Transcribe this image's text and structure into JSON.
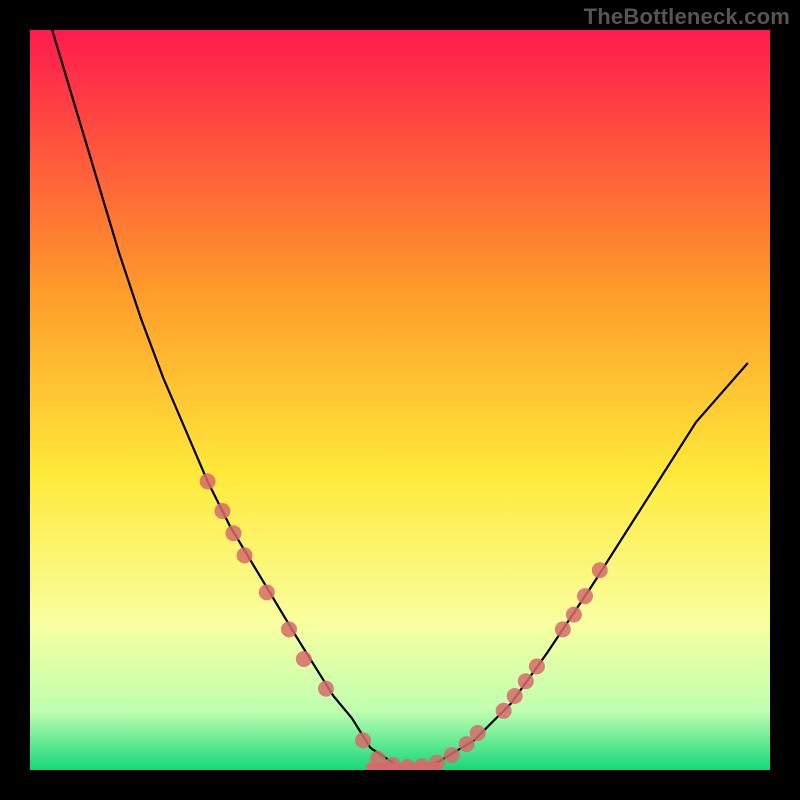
{
  "watermark": "TheBottleneck.com",
  "chart_data": {
    "type": "line",
    "title": "",
    "xlabel": "",
    "ylabel": "",
    "xlim": [
      0,
      100
    ],
    "ylim": [
      0,
      100
    ],
    "grid": false,
    "background_gradient": {
      "top": "#ff1a4e",
      "mid_upper": "#ff9a2a",
      "mid": "#ffe93a",
      "mid_lower": "#f9ffa0",
      "near_bottom": "#bfffb0",
      "bottom": "#15d87a"
    },
    "series": [
      {
        "name": "bottleneck-curve",
        "color": "#000000",
        "x": [
          3,
          6,
          9,
          12,
          15,
          18,
          21,
          24,
          27,
          30,
          33,
          36,
          38.5,
          41,
          43.5,
          46,
          49,
          52,
          55,
          60,
          65,
          70,
          76,
          83,
          90,
          97
        ],
        "y": [
          100,
          90,
          80,
          70,
          61,
          53,
          46,
          39,
          33,
          28,
          23,
          18,
          14,
          10,
          7,
          3,
          1,
          0,
          1,
          4,
          9,
          16,
          25,
          36,
          47,
          55
        ]
      }
    ],
    "markers": [
      {
        "name": "highlighted-points",
        "color": "#d66b6b",
        "radius": 8,
        "points": [
          {
            "x": 24,
            "y": 39
          },
          {
            "x": 26,
            "y": 35
          },
          {
            "x": 27.5,
            "y": 32
          },
          {
            "x": 29,
            "y": 29
          },
          {
            "x": 32,
            "y": 24
          },
          {
            "x": 35,
            "y": 19
          },
          {
            "x": 37,
            "y": 15
          },
          {
            "x": 40,
            "y": 11
          },
          {
            "x": 45,
            "y": 4
          },
          {
            "x": 47,
            "y": 1.5
          },
          {
            "x": 49,
            "y": 0.7
          },
          {
            "x": 51,
            "y": 0.4
          },
          {
            "x": 53,
            "y": 0.5
          },
          {
            "x": 55,
            "y": 1
          },
          {
            "x": 57,
            "y": 2
          },
          {
            "x": 59,
            "y": 3.5
          },
          {
            "x": 60.5,
            "y": 5
          },
          {
            "x": 64,
            "y": 8
          },
          {
            "x": 65.5,
            "y": 10
          },
          {
            "x": 67,
            "y": 12
          },
          {
            "x": 68.5,
            "y": 14
          },
          {
            "x": 72,
            "y": 19
          },
          {
            "x": 73.5,
            "y": 21
          },
          {
            "x": 75,
            "y": 23.5
          },
          {
            "x": 77,
            "y": 27
          }
        ]
      }
    ],
    "flat_segment": {
      "x0": 46,
      "x1": 55,
      "y": 0.3,
      "stroke": "#d66b6b",
      "width": 10
    }
  }
}
